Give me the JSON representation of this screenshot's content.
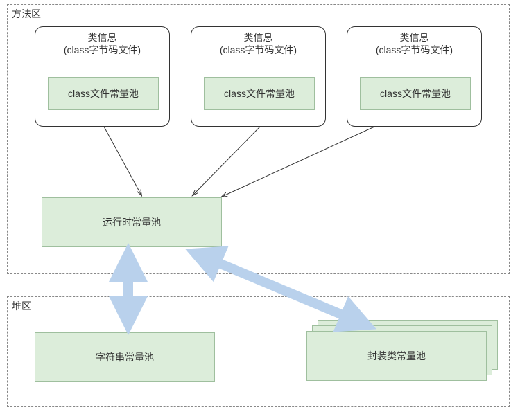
{
  "zones": {
    "method_area": "方法区",
    "heap_area": "堆区"
  },
  "class_info": {
    "title_line1": "类信息",
    "title_line2": "(class字节码文件)",
    "file_pool": "class文件常量池"
  },
  "runtime_pool": "运行时常量池",
  "string_pool": "字符串常量池",
  "wrapper_pool": "封装类常量池"
}
